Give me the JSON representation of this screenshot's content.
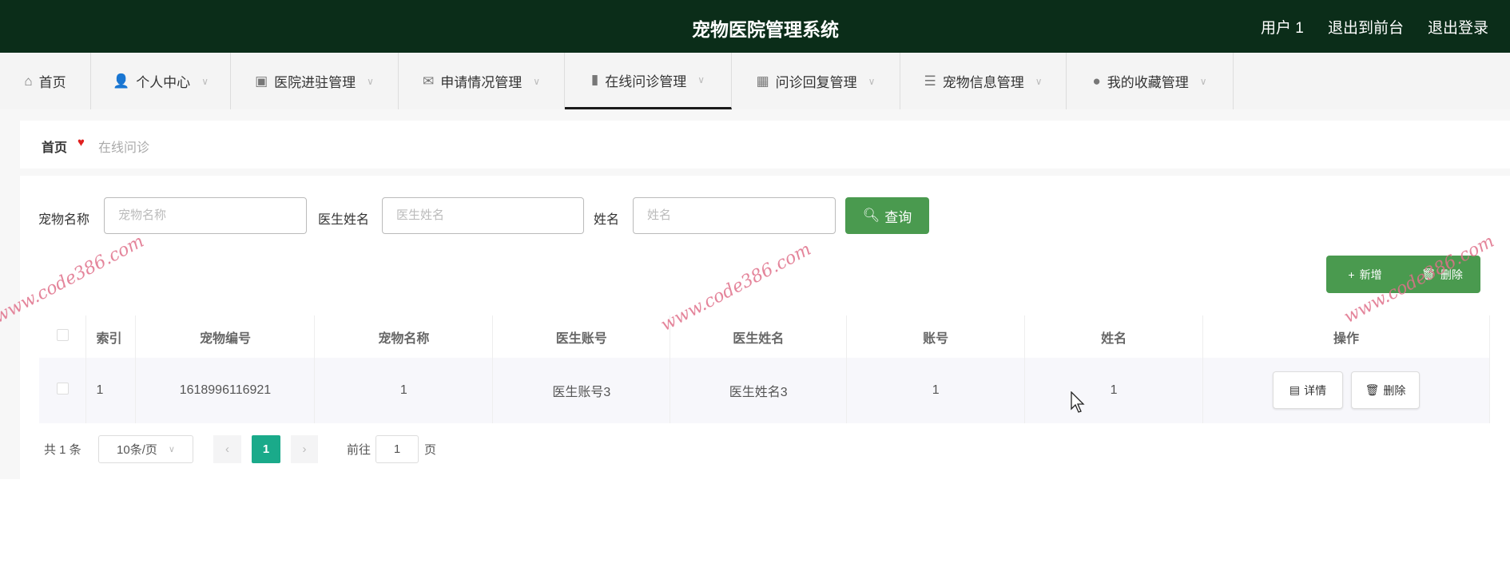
{
  "header": {
    "title": "宠物医院管理系统",
    "user": "用户 1",
    "to_front": "退出到前台",
    "logout": "退出登录"
  },
  "nav": [
    {
      "label": "首页",
      "icon": "home-icon"
    },
    {
      "label": "个人中心",
      "icon": "user-icon"
    },
    {
      "label": "医院进驻管理",
      "icon": "clipboard-icon"
    },
    {
      "label": "申请情况管理",
      "icon": "mail-icon"
    },
    {
      "label": "在线问诊管理",
      "icon": "bar-chart-icon",
      "active": true
    },
    {
      "label": "问诊回复管理",
      "icon": "grid-icon"
    },
    {
      "label": "宠物信息管理",
      "icon": "sliders-icon"
    },
    {
      "label": "我的收藏管理",
      "icon": "bulb-icon"
    }
  ],
  "breadcrumb": {
    "home": "首页",
    "current": "在线问诊"
  },
  "search": {
    "fields": [
      {
        "label": "宠物名称",
        "placeholder": "宠物名称"
      },
      {
        "label": "医生姓名",
        "placeholder": "医生姓名"
      },
      {
        "label": "姓名",
        "placeholder": "姓名"
      }
    ],
    "query_label": "查询"
  },
  "actions": {
    "add": "新增",
    "delete": "删除"
  },
  "table": {
    "columns": [
      "索引",
      "宠物编号",
      "宠物名称",
      "医生账号",
      "医生姓名",
      "账号",
      "姓名",
      "操作"
    ],
    "rows": [
      {
        "index": "1",
        "pet_no": "1618996116921",
        "pet_name": "1",
        "doctor_account": "医生账号3",
        "doctor_name": "医生姓名3",
        "account": "1",
        "name": "1"
      }
    ],
    "detail": "详情",
    "delete": "删除"
  },
  "pagination": {
    "total": "共 1 条",
    "page_size": "10条/页",
    "current": "1",
    "goto": "前往",
    "goto_value": "1",
    "page_suffix": "页"
  },
  "watermark": "www.code386.com",
  "colors": {
    "header": "#0b2d19",
    "primary": "#4a9a4f",
    "page_active": "#1aaa8a"
  }
}
